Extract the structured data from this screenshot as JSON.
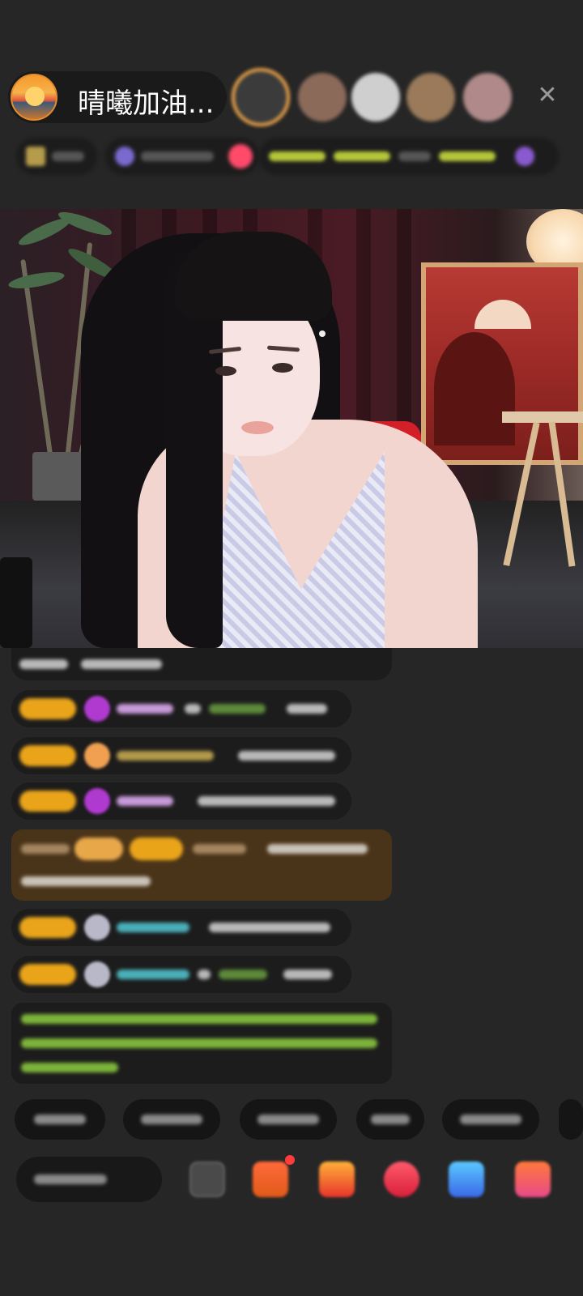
{
  "header": {
    "host_name": "晴曦加油...",
    "close_label": "✕"
  },
  "icons": {
    "close": "close-icon",
    "emoji": "emoji-icon",
    "gift": "gift-icon",
    "more": "more-icon"
  },
  "colors": {
    "background": "#262626",
    "badge": "#e9a41a",
    "highlight": "#4a3419",
    "green_text": "#7db53a"
  }
}
